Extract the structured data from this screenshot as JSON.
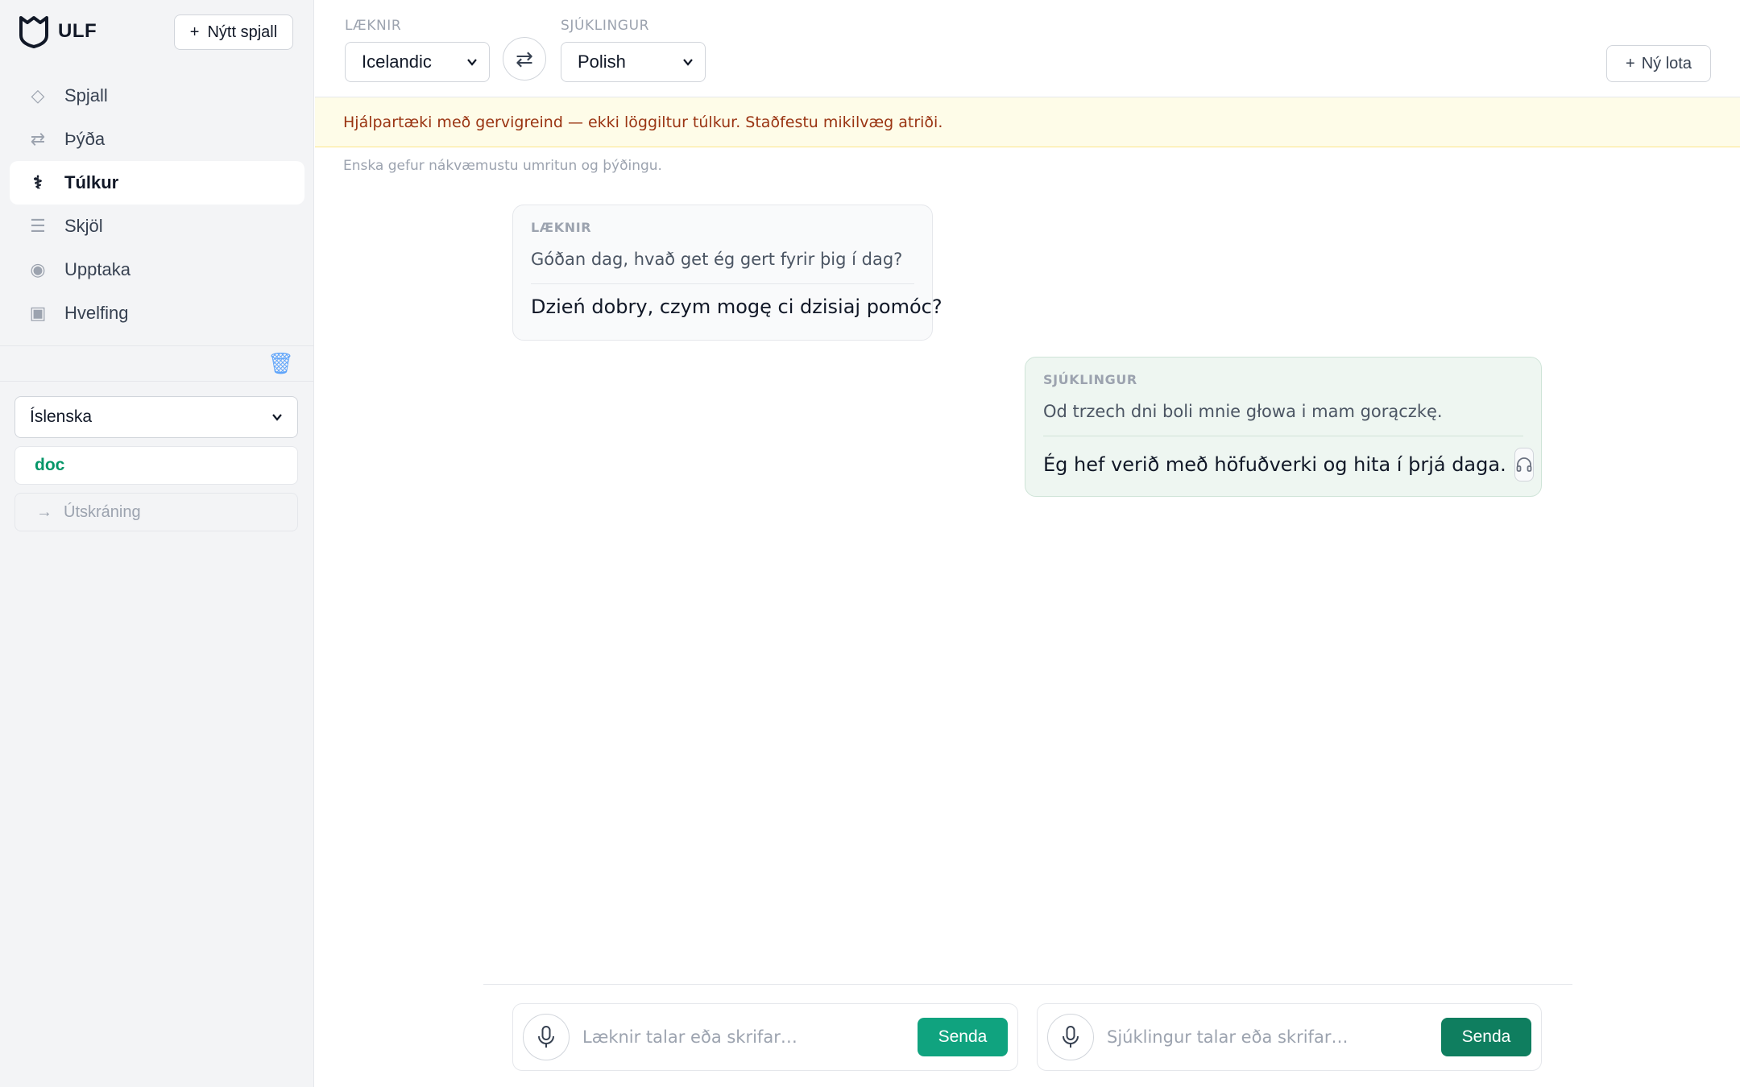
{
  "sidebar": {
    "brand": "ULF",
    "new_chat_label": "Nýtt spjall",
    "items": [
      {
        "label": "Spjall",
        "icon": "diamond-icon"
      },
      {
        "label": "Þýða",
        "icon": "swap-icon"
      },
      {
        "label": "Túlkur",
        "icon": "caduceus-icon",
        "active": true
      },
      {
        "label": "Skjöl",
        "icon": "list-icon"
      },
      {
        "label": "Upptaka",
        "icon": "record-icon"
      },
      {
        "label": "Hvelfing",
        "icon": "vault-icon"
      }
    ],
    "language": "Íslenska",
    "user": "doc",
    "logout_label": "Útskráning"
  },
  "header": {
    "doctor_label": "LÆKNIR",
    "doctor_language": "Icelandic",
    "patient_label": "SJÚKLINGUR",
    "patient_language": "Polish",
    "new_session_label": "Ný lota"
  },
  "warning": "Hjálpartæki með gervigreind — ekki löggiltur túlkur. Staðfestu mikilvæg atriði.",
  "note": "Enska gefur nákvæmustu umritun og þýðingu.",
  "messages": [
    {
      "role": "LÆKNIR",
      "original": "Góðan dag, hvað get ég gert fyrir þig í dag?",
      "translation": "Dzień dobry, czym mogę ci dzisiaj pomóc?"
    },
    {
      "role": "SJÚKLINGUR",
      "original": "Od trzech dni boli mnie głowa i mam gorączkę.",
      "translation": "Ég hef verið með höfuðverki og hita í þrjá daga."
    }
  ],
  "composer": {
    "doctor_placeholder": "Læknir talar eða skrifar…",
    "patient_placeholder": "Sjúklingur talar eða skrifar…",
    "send_label": "Senda"
  },
  "colors": {
    "accent": "#10a37f",
    "accent_dark": "#0f7e5f",
    "warning_bg": "#fefce8",
    "warning_text": "#9a3412",
    "user_green": "#059669"
  }
}
